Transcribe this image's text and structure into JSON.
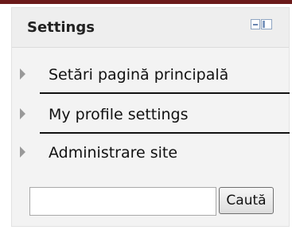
{
  "block": {
    "title": "Settings",
    "dock_icons": [
      "minimize-icon",
      "dock-panel-icon"
    ]
  },
  "items": [
    {
      "label": "Setări pagină principală",
      "icon": "triangle-right-icon"
    },
    {
      "label": "My profile settings",
      "icon": "triangle-right-icon"
    },
    {
      "label": "Administrare site",
      "icon": "triangle-right-icon"
    }
  ],
  "search": {
    "value": "",
    "button_label": "Caută"
  },
  "colors": {
    "header_bg": "#eeeeee",
    "block_bg": "#f3f3f3",
    "top_bar": "#6b1a1a",
    "arrow": "#999999"
  }
}
